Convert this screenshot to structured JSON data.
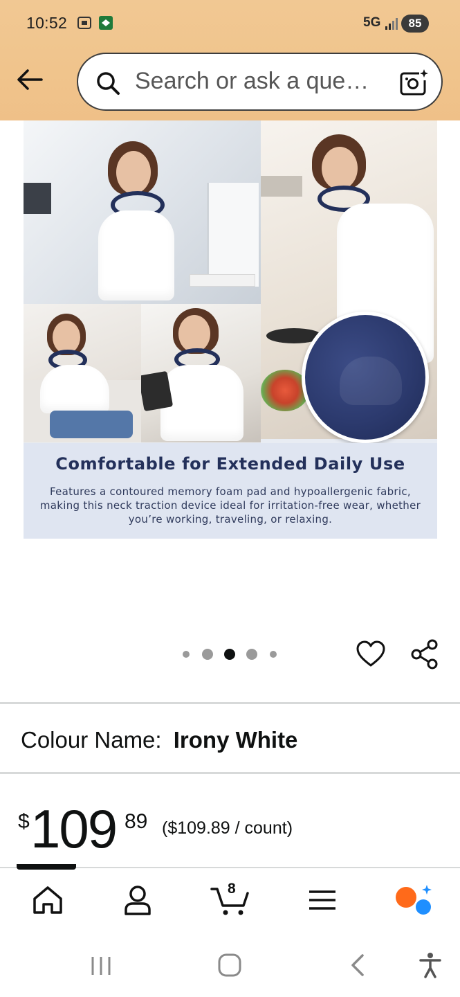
{
  "status_bar": {
    "time": "10:52",
    "network": "5G",
    "battery": "85"
  },
  "search": {
    "placeholder": "Search or ask a que…"
  },
  "product_image": {
    "headline": "Comfortable for Extended Daily Use",
    "description": "Features a contoured memory foam pad and hypoallergenic fabric, making this neck traction device ideal for irritation-free wear, whether you’re working, traveling, or relaxing.",
    "carousel_total": 5,
    "carousel_active_index": 3
  },
  "colour": {
    "label": "Colour Name:",
    "value": "Irony White"
  },
  "price": {
    "symbol": "$",
    "whole": "109",
    "fraction": "89",
    "unit_price": "($109.89 / count)"
  },
  "bottom_nav": {
    "cart_count": "8",
    "items": [
      "home-icon",
      "account-icon",
      "cart-icon",
      "menu-icon",
      "rufus-ai-icon"
    ]
  },
  "colors": {
    "header_bg": "#f0c48c",
    "navy": "#23305a",
    "accent_orange": "#ff6a1a",
    "accent_blue": "#1f8fff"
  }
}
